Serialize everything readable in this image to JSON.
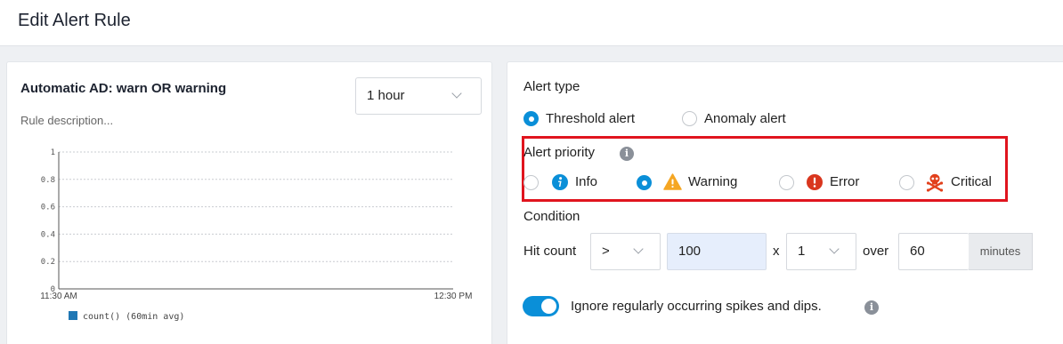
{
  "page": {
    "title": "Edit Alert Rule"
  },
  "left": {
    "rule_name": "Automatic AD: warn OR warning",
    "description_placeholder": "Rule description...",
    "time_range": "1 hour"
  },
  "chart_data": {
    "type": "line",
    "title": "",
    "xlabel": "",
    "ylabel": "",
    "x_ticks": [
      "11:30 AM",
      "12:30 PM"
    ],
    "y_ticks": [
      "1",
      "0.8",
      "0.6",
      "0.4",
      "0.2",
      "0"
    ],
    "ylim": [
      0,
      1
    ],
    "grid": true,
    "legend_position": "bottom",
    "series": [
      {
        "name": "count() (60min avg)",
        "values": [],
        "color": "#1f77b4"
      }
    ]
  },
  "alert_type": {
    "label": "Alert type",
    "options": [
      {
        "label": "Threshold alert",
        "selected": true
      },
      {
        "label": "Anomaly alert",
        "selected": false
      }
    ]
  },
  "alert_priority": {
    "label": "Alert priority",
    "info_glyph": "i",
    "highlight_color": "#e0141e",
    "options": [
      {
        "label": "Info",
        "selected": false,
        "icon": "info-circle-icon",
        "color": "#0a8fd8"
      },
      {
        "label": "Warning",
        "selected": true,
        "icon": "warning-triangle-icon",
        "color": "#f5a623"
      },
      {
        "label": "Error",
        "selected": false,
        "icon": "error-circle-icon",
        "color": "#d9361e"
      },
      {
        "label": "Critical",
        "selected": false,
        "icon": "skull-crossbones-icon",
        "color": "#e2401c"
      }
    ]
  },
  "condition": {
    "label": "Condition",
    "hit_count_label": "Hit count",
    "operator": ">",
    "threshold": "100",
    "times_label": "x",
    "multiplier": "1",
    "over_label": "over",
    "window": "60",
    "window_unit": "minutes"
  },
  "ignore_spikes": {
    "enabled": true,
    "label": "Ignore regularly occurring spikes and dips."
  },
  "colors": {
    "accent": "#0a8fd8"
  }
}
